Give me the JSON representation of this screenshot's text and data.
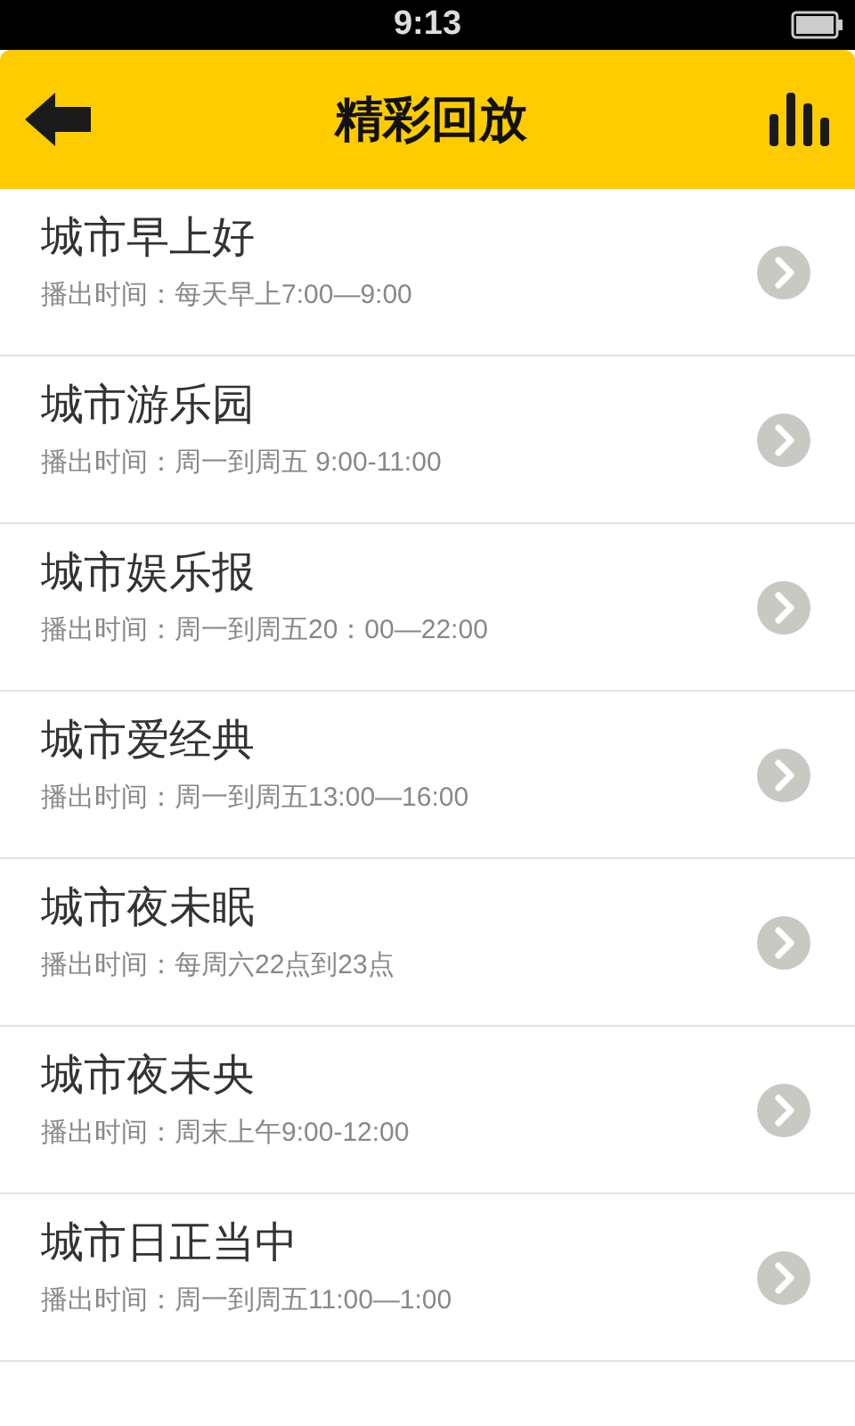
{
  "status_bar": {
    "time": "9:13"
  },
  "header": {
    "title": "精彩回放"
  },
  "programs": [
    {
      "title": "城市早上好",
      "schedule": "播出时间：每天早上7:00—9:00"
    },
    {
      "title": "城市游乐园",
      "schedule": "播出时间：周一到周五 9:00-11:00"
    },
    {
      "title": "城市娱乐报",
      "schedule": "播出时间：周一到周五20：00—22:00"
    },
    {
      "title": "城市爱经典",
      "schedule": "播出时间：周一到周五13:00—16:00"
    },
    {
      "title": "城市夜未眠",
      "schedule": "播出时间：每周六22点到23点"
    },
    {
      "title": "城市夜未央",
      "schedule": "播出时间：周末上午9:00-12:00"
    },
    {
      "title": "城市日正当中",
      "schedule": "播出时间：周一到周五11:00—1:00"
    }
  ]
}
